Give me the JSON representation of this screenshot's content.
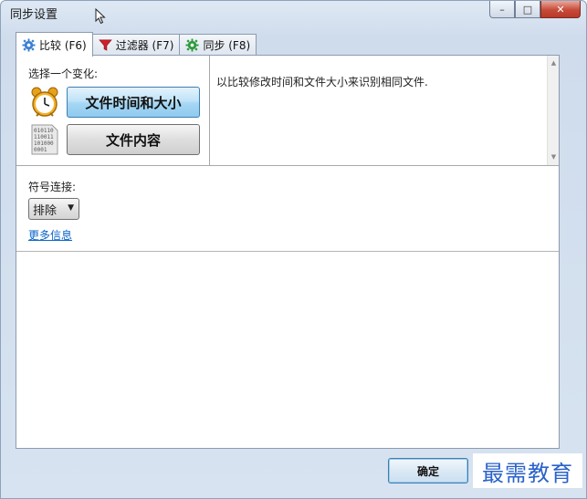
{
  "window": {
    "title": "同步设置",
    "controls": {
      "minimize": "–",
      "maximize": "□",
      "close": "✕"
    }
  },
  "tabs": [
    {
      "label": "比较 (F6)",
      "icon": "gear-icon",
      "active": true
    },
    {
      "label": "过滤器 (F7)",
      "icon": "filter-icon",
      "active": false
    },
    {
      "label": "同步 (F8)",
      "icon": "gear-green-icon",
      "active": false
    }
  ],
  "compare": {
    "choose_label": "选择一个变化:",
    "variants": [
      {
        "label": "文件时间和大小",
        "icon": "alarm-clock-icon",
        "selected": true
      },
      {
        "label": "文件内容",
        "icon": "binary-file-icon",
        "selected": false
      }
    ],
    "description": "以比较修改时间和文件大小来识别相同文件.",
    "symlink_label": "符号连接:",
    "symlink_value": "排除",
    "more_info": "更多信息"
  },
  "footer": {
    "ok_label": "确定",
    "watermark": "最需教育"
  },
  "colors": {
    "accent_blue": "#8fcaef",
    "link": "#0a64c8",
    "close_red": "#c74a38",
    "watermark": "#2a62c9"
  }
}
